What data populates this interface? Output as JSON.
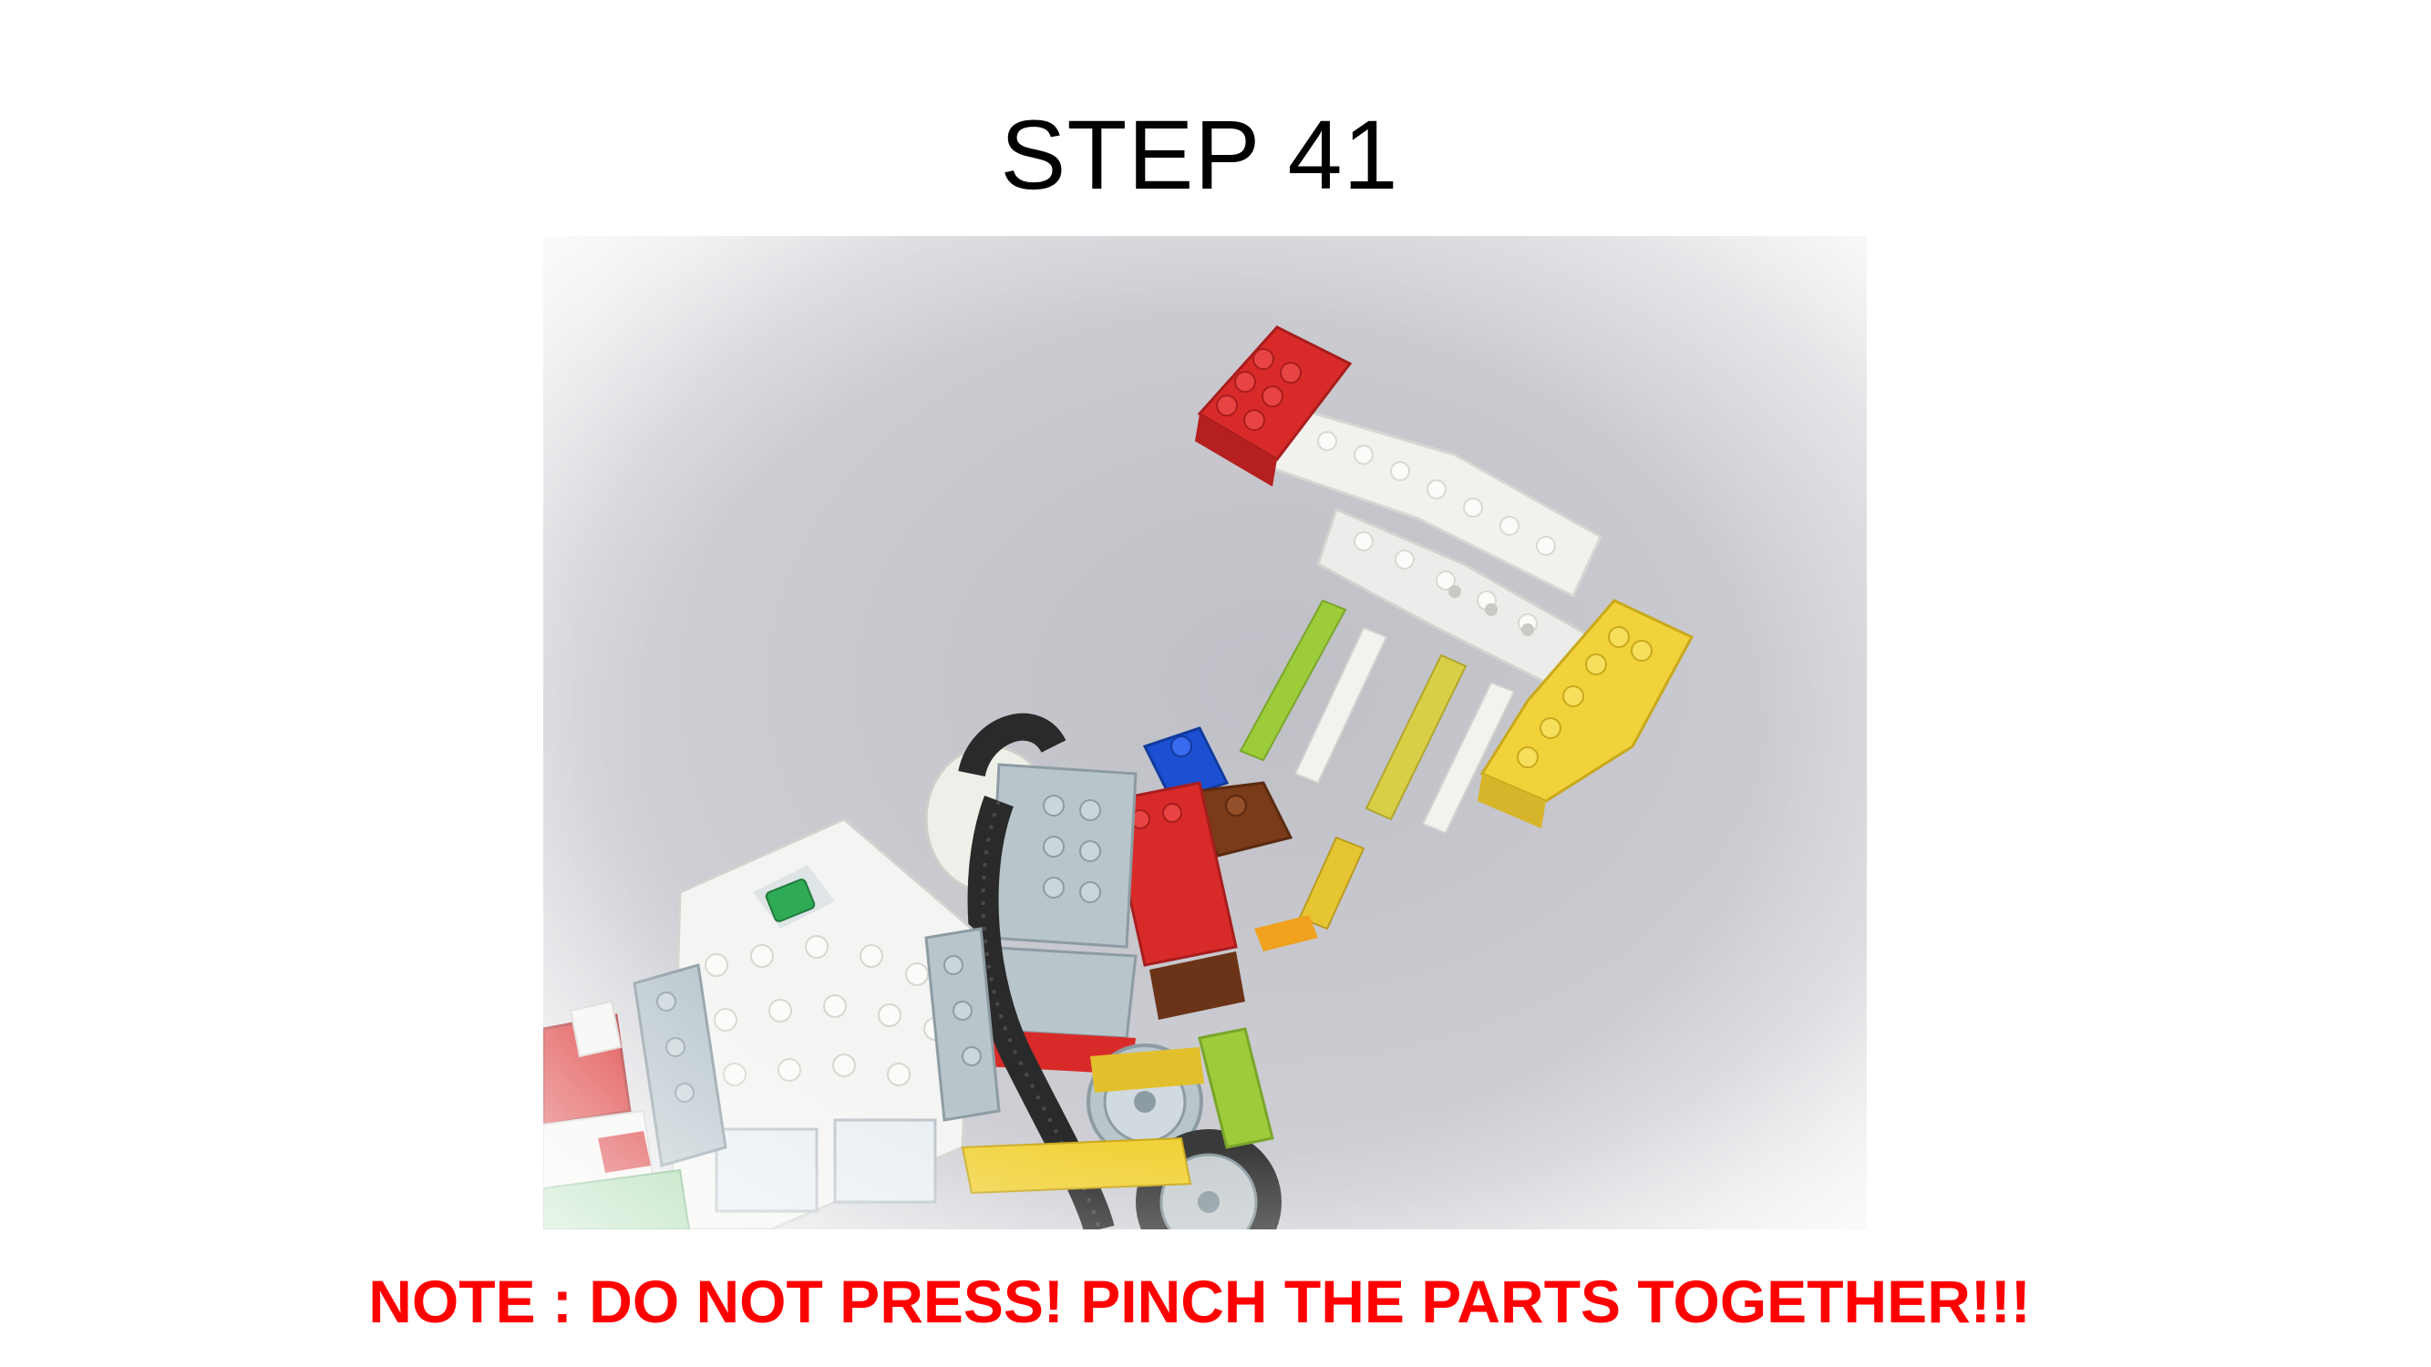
{
  "slide": {
    "title": "STEP 41",
    "note": "NOTE : DO NOT PRESS! PINCH THE PARTS TOGETHER!!!"
  },
  "photo": {
    "subject": "lego-model-step-41",
    "colors": {
      "red": "#d92a2a",
      "white": "#f4f4f2",
      "yellow": "#f1d23b",
      "lime": "#9ccc3a",
      "blue": "#1c4fd1",
      "brown": "#7a3b1a",
      "light_bluish_gray": "#b8c6cc",
      "black": "#2a2a2a",
      "green": "#2faa55"
    }
  }
}
